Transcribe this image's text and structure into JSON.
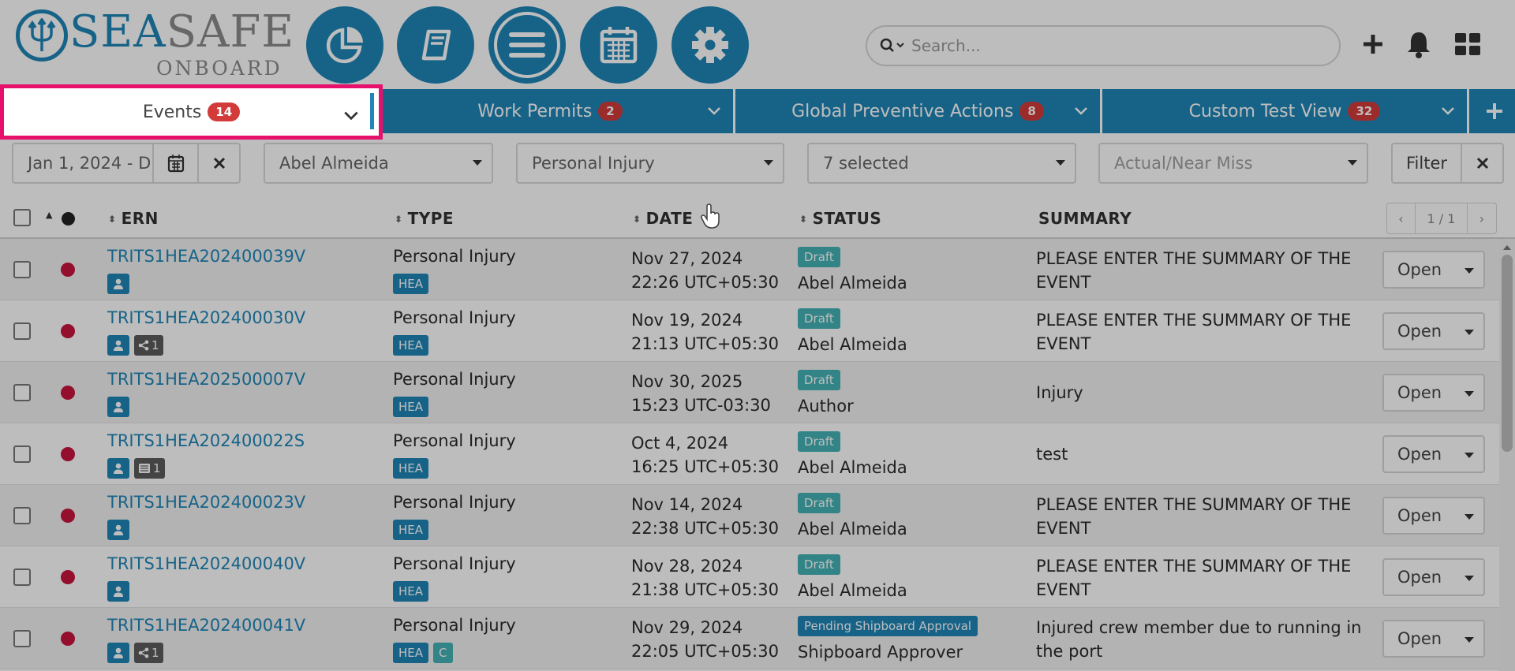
{
  "brand": {
    "sea": "SEA",
    "safe": "SAFE",
    "sub": "ONBOARD",
    "color": "#1f86b8"
  },
  "nav_icons": [
    "pie-chart-icon",
    "book-icon",
    "menu-icon",
    "calendar-icon",
    "gear-icon"
  ],
  "search": {
    "placeholder": "Search..."
  },
  "tabs": [
    {
      "label": "Events",
      "count": "14",
      "active": true
    },
    {
      "label": "Work Permits",
      "count": "2"
    },
    {
      "label": "Global Preventive Actions",
      "count": "8"
    },
    {
      "label": "Custom Test View",
      "count": "32"
    }
  ],
  "filters": {
    "date_range": "Jan 1, 2024 - D",
    "person": "Abel Almeida",
    "event_type": "Personal Injury",
    "statuses": "7 selected",
    "actual_near_miss_placeholder": "Actual/Near Miss",
    "filter_label": "Filter"
  },
  "table": {
    "headers": {
      "ern": "ERN",
      "type": "TYPE",
      "date": "DATE",
      "status": "STATUS",
      "summary": "SUMMARY"
    },
    "pager": "1 / 1",
    "open_label": "Open",
    "rows": [
      {
        "ern": "TRITS1HEA202400039V",
        "extra_tag": "",
        "type": "Personal Injury",
        "code": "HEA",
        "code2": "",
        "date": "Nov 27, 2024",
        "time": "22:26 UTC+05:30",
        "status": "Draft",
        "owner": "Abel Almeida",
        "summary": "PLEASE ENTER THE SUMMARY OF THE EVENT"
      },
      {
        "ern": "TRITS1HEA202400030V",
        "extra_tag": "share 1",
        "type": "Personal Injury",
        "code": "HEA",
        "code2": "",
        "date": "Nov 19, 2024",
        "time": "21:13 UTC+05:30",
        "status": "Draft",
        "owner": "Abel Almeida",
        "summary": "PLEASE ENTER THE SUMMARY OF THE EVENT"
      },
      {
        "ern": "TRITS1HEA202500007V",
        "extra_tag": "",
        "type": "Personal Injury",
        "code": "HEA",
        "code2": "",
        "date": "Nov 30, 2025",
        "time": "15:23 UTC-03:30",
        "status": "Draft",
        "owner": "Author",
        "summary": "Injury"
      },
      {
        "ern": "TRITS1HEA202400022S",
        "extra_tag": "list 1",
        "type": "Personal Injury",
        "code": "HEA",
        "code2": "",
        "date": "Oct 4, 2024",
        "time": "16:25 UTC+05:30",
        "status": "Draft",
        "owner": "Abel Almeida",
        "summary": "test"
      },
      {
        "ern": "TRITS1HEA202400023V",
        "extra_tag": "",
        "type": "Personal Injury",
        "code": "HEA",
        "code2": "",
        "date": "Nov 14, 2024",
        "time": "22:38 UTC+05:30",
        "status": "Draft",
        "owner": "Abel Almeida",
        "summary": "PLEASE ENTER THE SUMMARY OF THE EVENT"
      },
      {
        "ern": "TRITS1HEA202400040V",
        "extra_tag": "",
        "type": "Personal Injury",
        "code": "HEA",
        "code2": "",
        "date": "Nov 28, 2024",
        "time": "21:38 UTC+05:30",
        "status": "Draft",
        "owner": "Abel Almeida",
        "summary": "PLEASE ENTER THE SUMMARY OF THE EVENT"
      },
      {
        "ern": "TRITS1HEA202400041V",
        "extra_tag": "share 1",
        "type": "Personal Injury",
        "code": "HEA",
        "code2": "C",
        "date": "Nov 29, 2024",
        "time": "22:05 UTC+05:30",
        "status": "Pending Shipboard Approval",
        "owner": "Shipboard Approver",
        "summary": "Injured crew member due to running in the port"
      }
    ]
  },
  "colors": {
    "primary": "#1f86b8",
    "draft": "#44b3b6",
    "danger": "#d33b3b",
    "highlight": "#e7106d",
    "status_dot": "#c8143d"
  }
}
